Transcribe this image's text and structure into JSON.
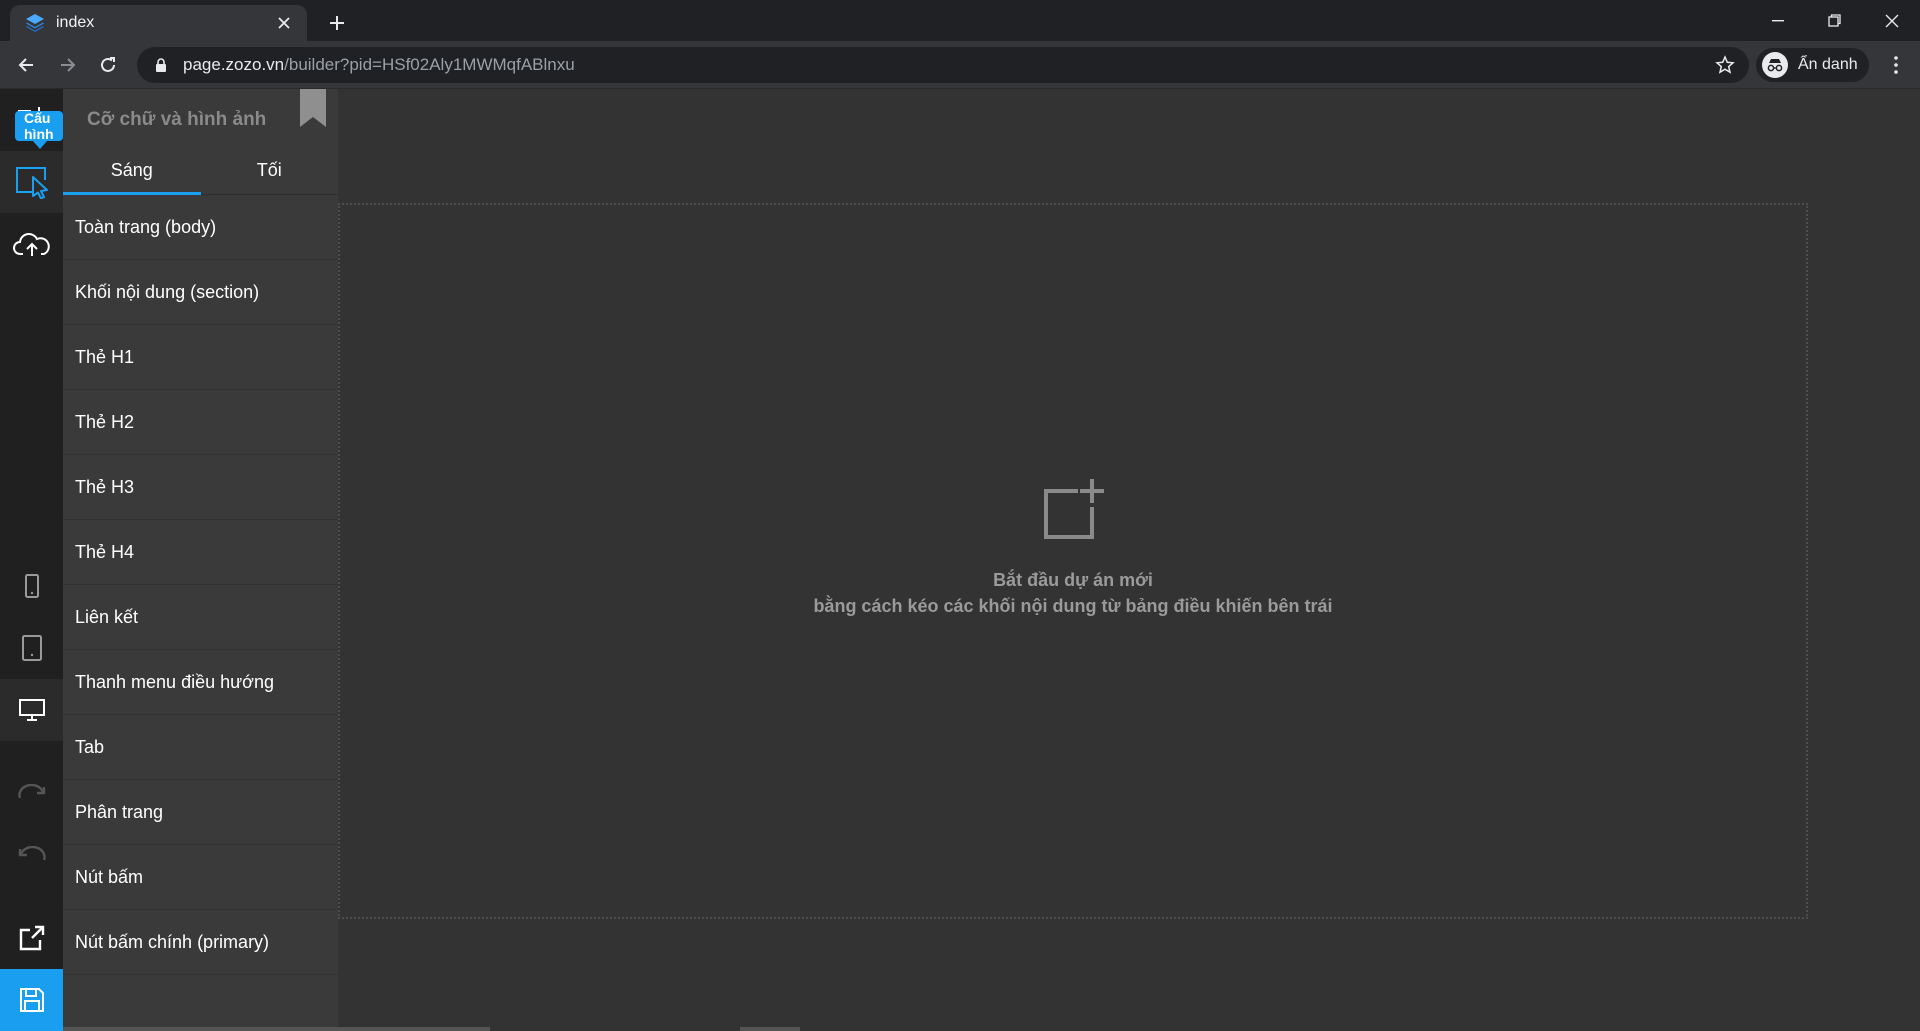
{
  "browser": {
    "tab_title": "index",
    "url_host": "page.zozo.vn",
    "url_path": "/builder?pid=HSf02Aly1MWMqfABlnxu",
    "profile_label": "Ẩn danh"
  },
  "rail": {
    "tooltip": "Cấu hình"
  },
  "panel": {
    "title": "Cỡ chữ và hình ảnh",
    "tabs": [
      "Sáng",
      "Tối"
    ],
    "items": [
      "Toàn trang (body)",
      "Khối nội dung (section)",
      "Thẻ H1",
      "Thẻ H2",
      "Thẻ H3",
      "Thẻ H4",
      "Liên kết",
      "Thanh menu điều hướng",
      "Tab",
      "Phân trang",
      "Nút bấm",
      "Nút bấm chính (primary)"
    ]
  },
  "canvas": {
    "line1": "Bắt đầu dự án mới",
    "line2": "bằng cách kéo các khối nội dung từ bảng điều khiến bên trái"
  },
  "colors": {
    "accent": "#1a9ff0",
    "chrome_bg": "#202124",
    "app_bg": "#333333"
  }
}
